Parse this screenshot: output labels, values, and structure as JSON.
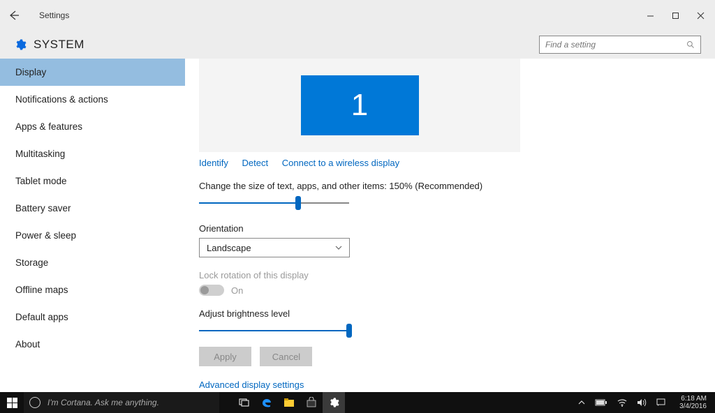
{
  "titlebar": {
    "app_name": "Settings"
  },
  "header": {
    "title": "SYSTEM",
    "search_placeholder": "Find a setting"
  },
  "sidebar": {
    "items": [
      {
        "label": "Display",
        "selected": true
      },
      {
        "label": "Notifications & actions"
      },
      {
        "label": "Apps & features"
      },
      {
        "label": "Multitasking"
      },
      {
        "label": "Tablet mode"
      },
      {
        "label": "Battery saver"
      },
      {
        "label": "Power & sleep"
      },
      {
        "label": "Storage"
      },
      {
        "label": "Offline maps"
      },
      {
        "label": "Default apps"
      },
      {
        "label": "About"
      }
    ]
  },
  "display": {
    "monitor_number": "1",
    "links": {
      "identify": "Identify",
      "detect": "Detect",
      "wireless": "Connect to a wireless display"
    },
    "scale_label": "Change the size of text, apps, and other items: 150% (Recommended)",
    "scale_slider_percent": 66,
    "orientation_label": "Orientation",
    "orientation_value": "Landscape",
    "lock_rotation_label": "Lock rotation of this display",
    "lock_rotation_state": "On",
    "brightness_label": "Adjust brightness level",
    "brightness_slider_percent": 100,
    "apply_label": "Apply",
    "cancel_label": "Cancel",
    "advanced_link": "Advanced display settings"
  },
  "taskbar": {
    "cortana_placeholder": "I'm Cortana. Ask me anything.",
    "time": "6:18 AM",
    "date": "3/4/2016"
  }
}
